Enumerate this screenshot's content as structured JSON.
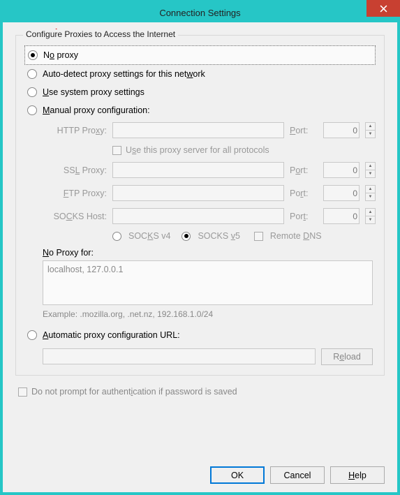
{
  "title": "Connection Settings",
  "groupLegend": "Configure Proxies to Access the Internet",
  "radios": {
    "noProxy": "No proxy",
    "autoDetect": "Auto-detect proxy settings for this network",
    "system": "Use system proxy settings",
    "manual": "Manual proxy configuration:",
    "autoUrl": "Automatic proxy configuration URL:"
  },
  "fields": {
    "http": "HTTP Proxy:",
    "ssl": "SSL Proxy:",
    "ftp": "FTP Proxy:",
    "socks": "SOCKS Host:",
    "port": "Port:",
    "portValue": "0"
  },
  "useAll": "Use this proxy server for all protocols",
  "socksV4": "SOCKS v4",
  "socksV5": "SOCKS v5",
  "remoteDns": "Remote DNS",
  "noProxyFor": "No Proxy for:",
  "noProxyValue": "localhost, 127.0.0.1",
  "example": "Example: .mozilla.org, .net.nz, 192.168.1.0/24",
  "reload": "Reload",
  "dontPrompt": "Do not prompt for authentication if password is saved",
  "buttons": {
    "ok": "OK",
    "cancel": "Cancel",
    "help": "Help"
  }
}
